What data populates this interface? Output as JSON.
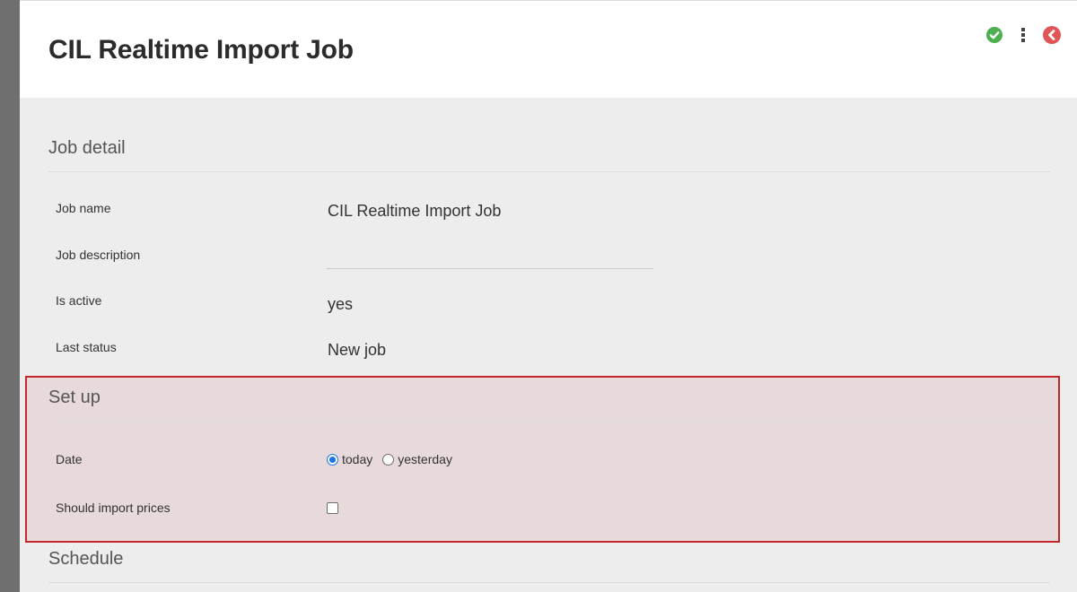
{
  "header": {
    "title": "CIL Realtime Import Job",
    "icons": [
      "check-circle-icon",
      "more-vertical-icon",
      "back-circle-icon"
    ],
    "colors": {
      "confirm": "#4caf50",
      "back": "#e05555",
      "menu": "#444444"
    }
  },
  "job_detail": {
    "title": "Job detail",
    "fields": [
      {
        "label": "Job name",
        "value": "CIL Realtime Import Job"
      },
      {
        "label": "Job description",
        "value": ""
      },
      {
        "label": "Is active",
        "value": "yes"
      },
      {
        "label": "Last status",
        "value": "New job"
      }
    ]
  },
  "setup": {
    "title": "Set up",
    "highlight_color": "#c0282e",
    "date": {
      "label": "Date",
      "options": [
        "today",
        "yesterday"
      ],
      "selected": "today"
    },
    "import_prices": {
      "label": "Should import prices",
      "checked": false
    }
  },
  "schedule": {
    "title": "Schedule"
  }
}
